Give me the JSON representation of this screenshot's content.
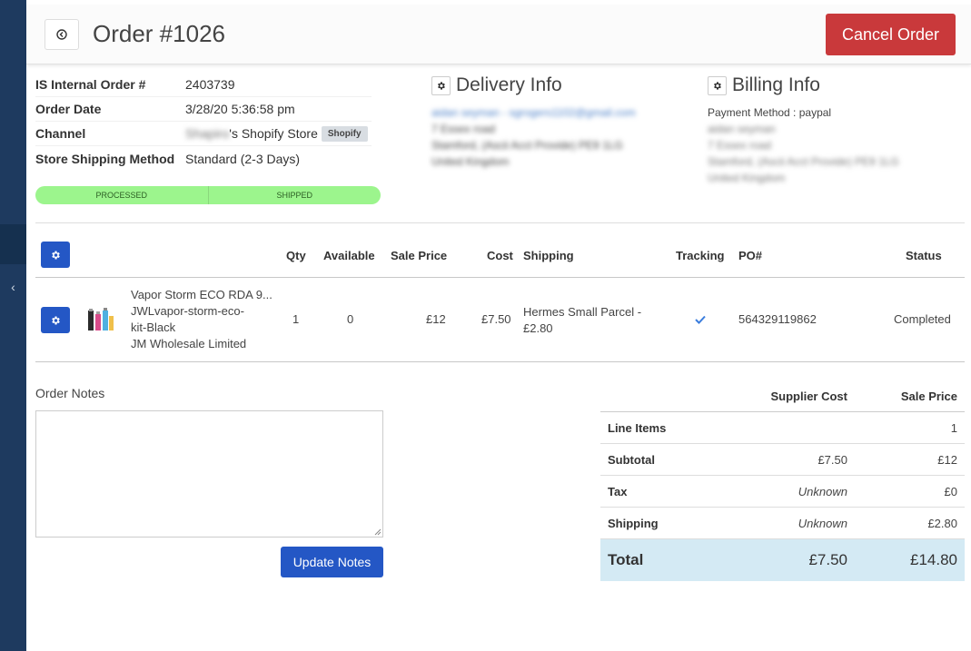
{
  "header": {
    "title": "Order #1026",
    "cancel_label": "Cancel Order"
  },
  "order_info": {
    "internal_order_label": "IS Internal Order #",
    "internal_order_value": "2403739",
    "order_date_label": "Order Date",
    "order_date_value": "3/28/20 5:36:58 pm",
    "channel_label": "Channel",
    "channel_owner": "Shapiro",
    "channel_store": "'s Shopify Store",
    "channel_tag": "Shopify",
    "shipping_method_label": "Store Shipping Method",
    "shipping_method_value": "Standard (2-3 Days)"
  },
  "progress": {
    "steps": [
      "PROCESSED",
      "SHIPPED"
    ],
    "color": "#9cf58d"
  },
  "delivery": {
    "title": "Delivery Info",
    "lines": [
      "aidan seyman - sgrogers1102@gmail.com",
      "7 Essex road",
      "Stamford, (Ascii Acct Provide) PE9 1LG",
      "United Kingdom"
    ]
  },
  "billing": {
    "title": "Billing Info",
    "payment_method": "Payment Method : paypal",
    "lines": [
      "aidan seyman",
      "7 Essex road",
      "Stamford, (Ascii Acct Provide) PE9 1LG",
      "United Kingdom"
    ]
  },
  "items": {
    "headers": {
      "qty": "Qty",
      "available": "Available",
      "sale_price": "Sale Price",
      "cost": "Cost",
      "shipping": "Shipping",
      "tracking": "Tracking",
      "po": "PO#",
      "status": "Status"
    },
    "rows": [
      {
        "name": "Vapor Storm ECO RDA 9...",
        "sku_line1": "JWLvapor-storm-eco-",
        "sku_line2": "kit-Black",
        "supplier": "JM Wholesale Limited",
        "qty": "1",
        "available": "0",
        "sale_price": "£12",
        "cost": "£7.50",
        "shipping_line1": "Hermes Small Parcel -",
        "shipping_line2": "£2.80",
        "po": "564329119862",
        "status": "Completed"
      }
    ]
  },
  "notes": {
    "label": "Order Notes",
    "value": "",
    "update_label": "Update Notes"
  },
  "totals": {
    "supplier_cost_header": "Supplier Cost",
    "sale_price_header": "Sale Price",
    "line_items_label": "Line Items",
    "line_items_sale": "1",
    "subtotal_label": "Subtotal",
    "subtotal_cost": "£7.50",
    "subtotal_sale": "£12",
    "tax_label": "Tax",
    "tax_cost": "Unknown",
    "tax_sale": "£0",
    "shipping_label": "Shipping",
    "shipping_cost": "Unknown",
    "shipping_sale": "£2.80",
    "total_label": "Total",
    "total_cost": "£7.50",
    "total_sale": "£14.80"
  },
  "colors": {
    "primary": "#2457c5",
    "danger": "#c9393b",
    "sidebar": "#1e3a5f",
    "total_row": "#d4eaf4",
    "tracking_check": "#3b7ddd"
  }
}
